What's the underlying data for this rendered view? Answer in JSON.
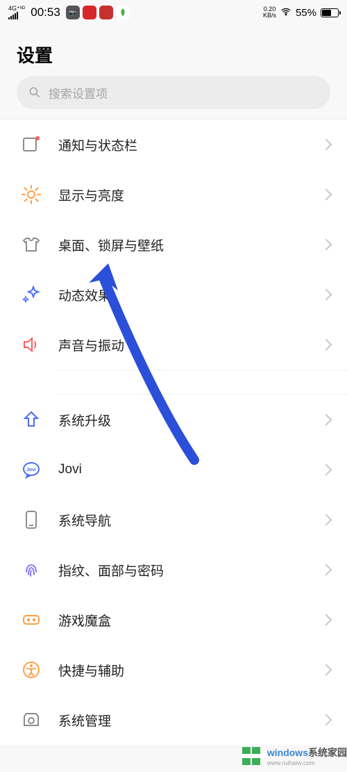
{
  "status_bar": {
    "network_type": "4G⁺ʰᴰ",
    "clock": "00:53",
    "speed_value": "0.20",
    "speed_unit": "KB/s",
    "battery_pct": "55%"
  },
  "page": {
    "title": "设置"
  },
  "search": {
    "placeholder": "搜索设置项"
  },
  "settings_groups": [
    {
      "items": [
        {
          "key": "notification",
          "label": "通知与状态栏",
          "icon": "notification-badge"
        },
        {
          "key": "display",
          "label": "显示与亮度",
          "icon": "brightness-sun"
        },
        {
          "key": "wallpaper",
          "label": "桌面、锁屏与壁纸",
          "icon": "tshirt"
        },
        {
          "key": "animation",
          "label": "动态效果",
          "icon": "sparkle"
        },
        {
          "key": "sound",
          "label": "声音与振动",
          "icon": "speaker"
        }
      ]
    },
    {
      "items": [
        {
          "key": "upgrade",
          "label": "系统升级",
          "icon": "arrow-up-fat"
        },
        {
          "key": "jovi",
          "label": "Jovi",
          "icon": "jovi-bubble"
        },
        {
          "key": "navigation",
          "label": "系统导航",
          "icon": "phone-outline"
        },
        {
          "key": "security",
          "label": "指纹、面部与密码",
          "icon": "fingerprint"
        },
        {
          "key": "gamebox",
          "label": "游戏魔盒",
          "icon": "gamepad"
        },
        {
          "key": "accessibility",
          "label": "快捷与辅助",
          "icon": "accessibility-person"
        },
        {
          "key": "system_mgmt",
          "label": "系统管理",
          "icon": "camera-outline"
        }
      ]
    }
  ],
  "watermark": {
    "text1": "windows",
    "text2": "系统家园",
    "sub": "www.ruihaiw.com"
  },
  "colors": {
    "accent_arrow": "#2b4fd8",
    "icon_orange": "#ff9f43",
    "icon_blue": "#4a6cf7",
    "icon_violet": "#7b6cf6",
    "icon_red": "#ff5c5c",
    "icon_gray": "#8c8c8c"
  }
}
